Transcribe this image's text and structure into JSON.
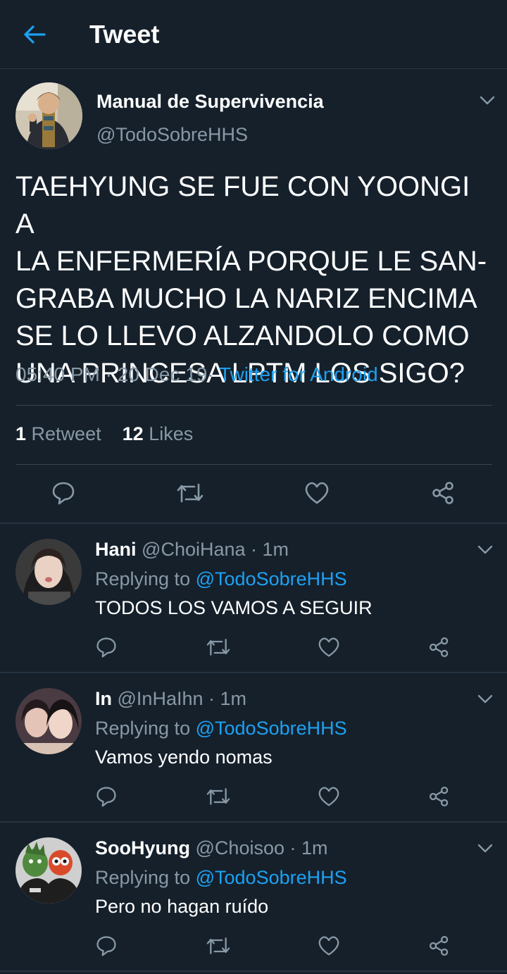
{
  "header": {
    "title": "Tweet"
  },
  "tweet": {
    "author_name": "Manual de Supervivencia",
    "author_handle": "@TodoSobreHHS",
    "text": "TAEHYUNG SE FUE CON YOONGI A LA ENFERMERÍA PORQUE LE SANGRABA MUCHO LA NARIZ ENCIMA SE LO LLEVO ALZANDOLO COMO UNA PRINCESA LPTM LOS SIGO?",
    "text_lines": [
      "TAEHYUNG SE FUE CON YOONGI A",
      "LA ENFERMERÍA PORQUE LE SAN-",
      "GRABA MUCHO LA NARIZ ENCIMA",
      "SE LO LLEVO ALZANDOLO COMO",
      "UNA PRINCESA LPTM LOS SIGO?"
    ],
    "time": "05:40 PM",
    "sep1": "·",
    "date": "20 Dec 19",
    "sep2": "·",
    "source": "Twitter for Android",
    "retweets_count": "1",
    "retweets_label": "Retweet",
    "likes_count": "12",
    "likes_label": "Likes"
  },
  "replies": [
    {
      "name": "Hani",
      "handle": "@ChoiHana",
      "time": "· 1m",
      "replying_label": "Replying to",
      "replying_to": "@TodoSobreHHS",
      "text": "TODOS LOS VAMOS A SEGUIR"
    },
    {
      "name": "In",
      "handle": "@InHaIhn",
      "time": "· 1m",
      "replying_label": "Replying to",
      "replying_to": "@TodoSobreHHS",
      "text": "Vamos yendo nomas"
    },
    {
      "name": "SooHyung",
      "handle": "@Choisoo",
      "time": "· 1m",
      "replying_label": "Replying to",
      "replying_to": "@TodoSobreHHS",
      "text": "Pero no hagan ruído"
    }
  ],
  "icons": {
    "back": "arrow-left-icon",
    "reply": "reply-icon",
    "retweet": "retweet-icon",
    "like": "heart-icon",
    "share": "share-icon",
    "more": "chevron-down-icon"
  },
  "colors": {
    "background": "#15202b",
    "accent": "#1da1f2",
    "secondary_text": "#8899a6",
    "divider": "#38444d"
  }
}
